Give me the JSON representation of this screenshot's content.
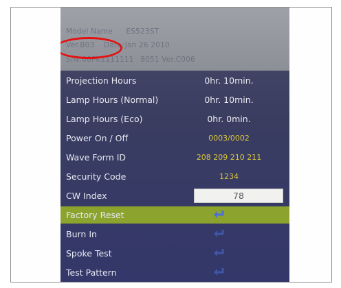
{
  "info": {
    "model_label": "Model Name",
    "model_value": "ES523ST",
    "ver_label": "Ver.",
    "ver_value": "B03",
    "date_label": "Date:",
    "date_value": "Jan 26 2010",
    "sn_label": "S/N:",
    "sn_value": "08FK1111111",
    "mcu_value": "8051 Ver.C006"
  },
  "menu": [
    {
      "label": "Projection Hours",
      "value": "0hr. 10min."
    },
    {
      "label": "Lamp Hours (Normal)",
      "value": "0hr. 10min."
    },
    {
      "label": "Lamp Hours (Eco)",
      "value": "0hr. 0min."
    },
    {
      "label": "Power On / Off",
      "value": "0003/0002"
    },
    {
      "label": "Wave Form ID",
      "value": "208 209 210 211"
    },
    {
      "label": "Security Code",
      "value": "1234"
    },
    {
      "label": "CW Index",
      "value": "78"
    },
    {
      "label": "Factory Reset",
      "icon": "enter-icon"
    },
    {
      "label": "Burn In",
      "icon": "enter-icon"
    },
    {
      "label": "Spoke Test",
      "icon": "enter-icon"
    },
    {
      "label": "Test Pattern",
      "icon": "enter-icon"
    }
  ],
  "colors": {
    "selected_row": "#8ca32e",
    "enter_icon": "#4a6fd8",
    "value_yellow": "#d8c63b",
    "annotation_circle": "#e31212"
  }
}
